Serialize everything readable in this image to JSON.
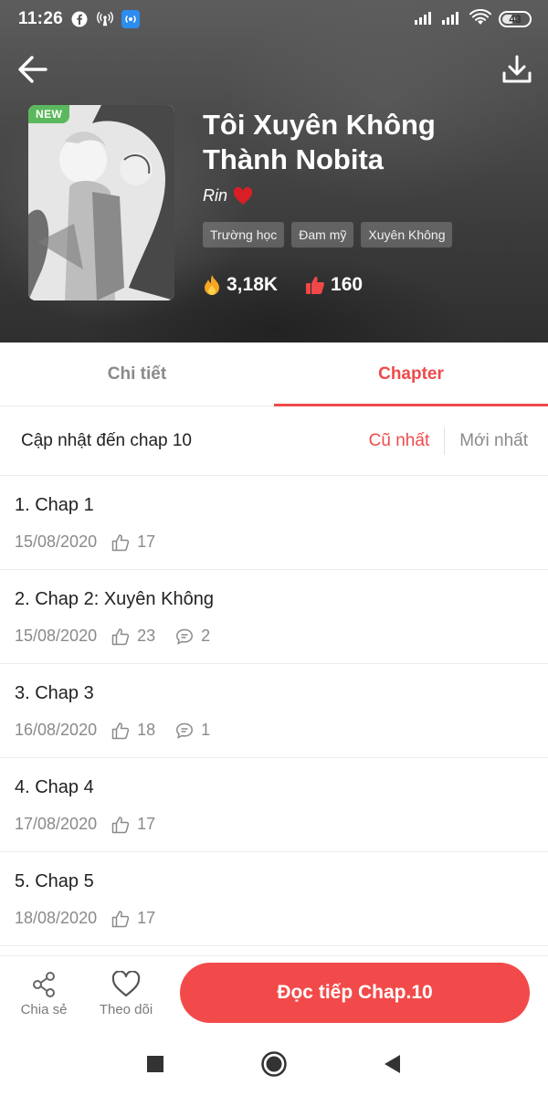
{
  "status_bar": {
    "time": "11:26",
    "battery": "43"
  },
  "story": {
    "badge": "NEW",
    "title": "Tôi Xuyên Không Thành Nobita",
    "author": "Rin",
    "tags": [
      "Trường học",
      "Đam mỹ",
      "Xuyên Không"
    ],
    "views": "3,18K",
    "likes": "160"
  },
  "tabs": [
    {
      "label": "Chi tiết",
      "active": false
    },
    {
      "label": "Chapter",
      "active": true
    }
  ],
  "sort_bar": {
    "update_label": "Cập nhật đến chap 10",
    "oldest": "Cũ nhất",
    "newest": "Mới nhất",
    "active": "oldest"
  },
  "chapters": [
    {
      "title": "1. Chap 1",
      "date": "15/08/2020",
      "likes": "17",
      "comments": ""
    },
    {
      "title": "2. Chap 2: Xuyên Không",
      "date": "15/08/2020",
      "likes": "23",
      "comments": "2"
    },
    {
      "title": "3. Chap 3",
      "date": "16/08/2020",
      "likes": "18",
      "comments": "1"
    },
    {
      "title": "4. Chap 4",
      "date": "17/08/2020",
      "likes": "17",
      "comments": ""
    },
    {
      "title": "5. Chap 5",
      "date": "18/08/2020",
      "likes": "17",
      "comments": ""
    }
  ],
  "bottom_bar": {
    "share_label": "Chia sẻ",
    "follow_label": "Theo dõi",
    "read_label": "Đọc tiếp Chap.10"
  },
  "colors": {
    "accent": "#ee4b4b",
    "new_badge": "#5cb85c",
    "muted": "#8a8a8a"
  },
  "icons": {
    "back": "arrow-left-icon",
    "download": "download-icon",
    "heart_author": "heart-icon",
    "views": "fire-icon",
    "likes": "thumbs-up-icon",
    "chapter_like": "thumbs-up-outline-icon",
    "chapter_comment": "comment-icon",
    "share": "share-icon",
    "follow": "heart-outline-icon"
  }
}
